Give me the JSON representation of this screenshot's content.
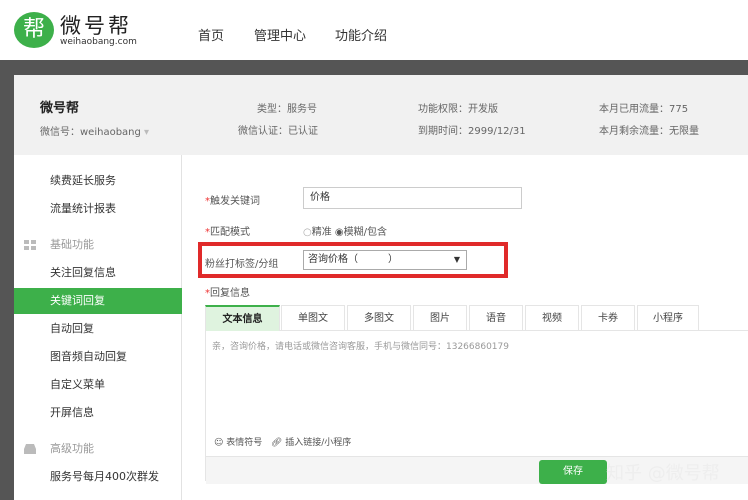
{
  "header": {
    "logo_glyph": "帮",
    "logo_name": "微号帮",
    "logo_url": "weihaobang.com",
    "nav": [
      "首页",
      "管理中心",
      "功能介绍"
    ]
  },
  "account": {
    "name": "微号帮",
    "wechat_id": "微信号：weihaobang",
    "type": "类型：服务号",
    "verify": "微信认证：已认证",
    "permission": "功能权限：开发版",
    "expire": "到期时间：2999/12/31",
    "used": "本月已用流量：775",
    "remain": "本月剩余流量：无限量"
  },
  "sidebar": {
    "items": [
      "续费延长服务",
      "流量统计报表"
    ],
    "group1": "基础功能",
    "basic": [
      "关注回复信息",
      "关键词回复",
      "自动回复",
      "图音频自动回复",
      "自定义菜单",
      "开屏信息"
    ],
    "group2": "高级功能",
    "advanced": [
      "服务号每月400次群发"
    ]
  },
  "form": {
    "keyword_label": "触发关键词",
    "keyword_value": "价格",
    "match_label": "匹配模式",
    "match_exact": "精准",
    "match_fuzzy": "模糊/包含",
    "tag_label": "粉丝打标签/分组",
    "tag_value": "咨询价格（　　　）",
    "reply_label": "回复信息",
    "required": "*",
    "tabs": [
      "文本信息",
      "单图文",
      "多图文",
      "图片",
      "语音",
      "视频",
      "卡券",
      "小程序"
    ],
    "reply_text": "亲，咨询价格，请电话或微信咨询客服，手机与微信同号：13266860179",
    "emoji": "表情符号",
    "link": "插入链接/小程序",
    "save": "保存",
    "watermark": "知乎 @微号帮"
  },
  "colors": {
    "accent": "#3db04a",
    "highlight": "#e02a2a"
  }
}
